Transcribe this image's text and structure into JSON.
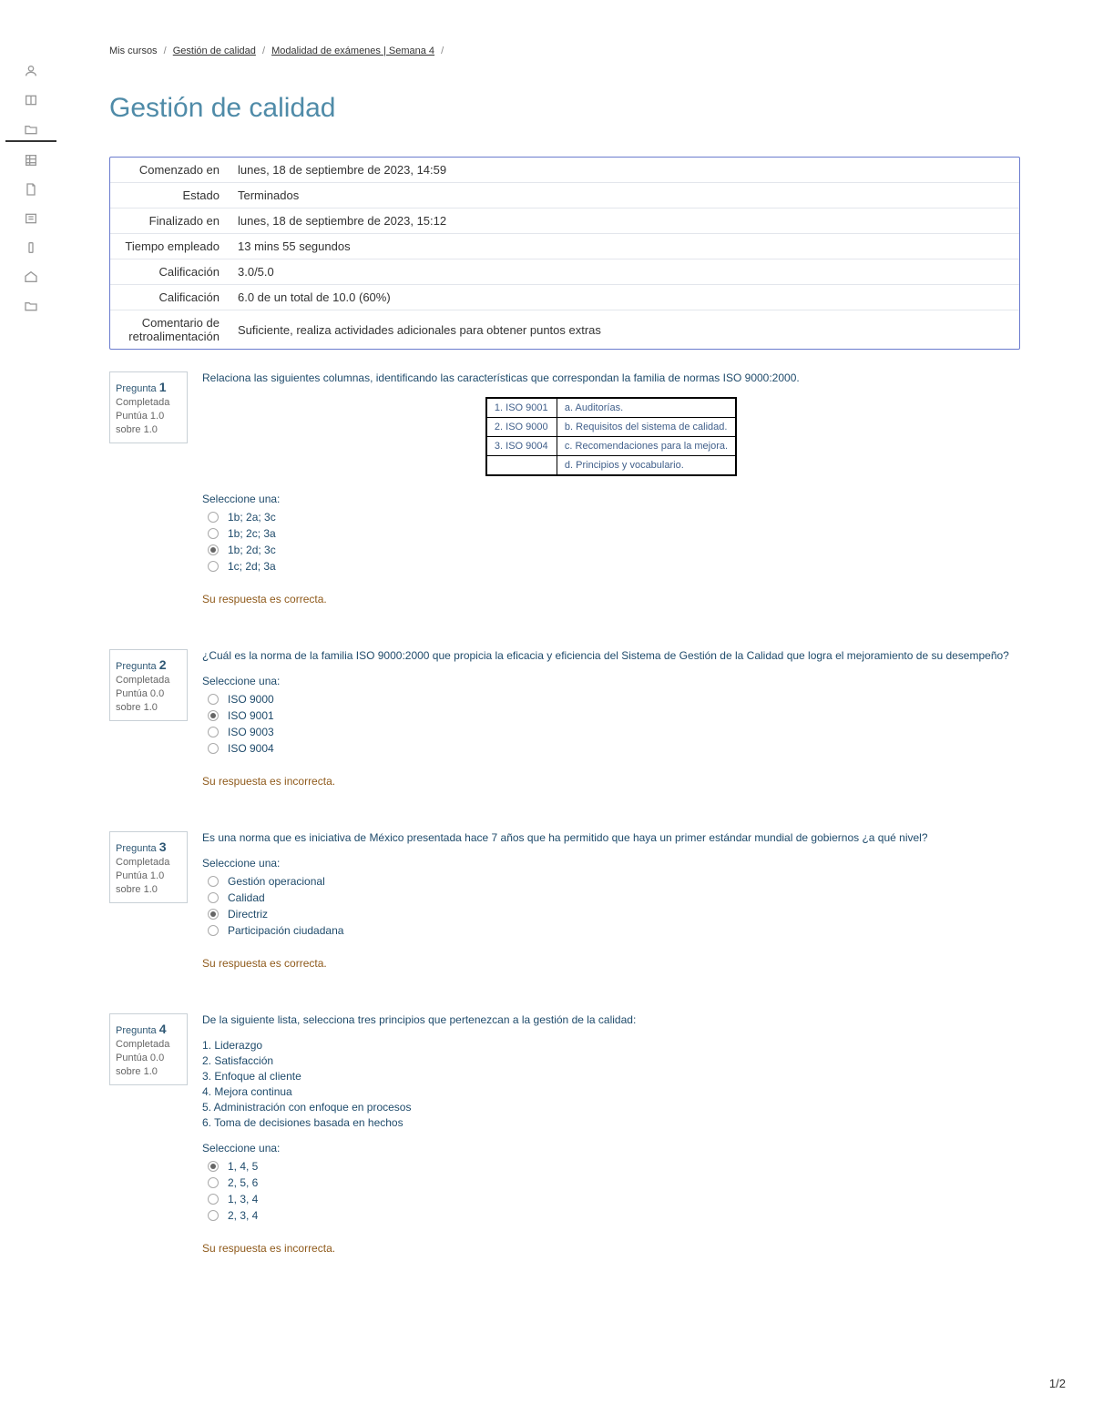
{
  "breadcrumb": {
    "i1": "Mis cursos",
    "i2": "Gestión de calidad",
    "i3": "Modalidad de exámenes | Semana 4"
  },
  "page_title": "Gestión de calidad",
  "summary": {
    "started_label": "Comenzado en",
    "started_value": "lunes, 18 de septiembre de 2023, 14:59",
    "state_label": "Estado",
    "state_value": "Terminados",
    "finished_label": "Finalizado en",
    "finished_value": "lunes, 18 de septiembre de 2023, 15:12",
    "time_label": "Tiempo empleado",
    "time_value": "13 mins 55 segundos",
    "grade1_label": "Calificación",
    "grade1_value": "3.0/5.0",
    "grade2_label": "Calificación",
    "grade2_value": "6.0 de un total de 10.0 (60%)",
    "feedback_label": "Comentario de retroalimentación",
    "feedback_value": "Suficiente, realiza actividades adicionales para obtener puntos extras"
  },
  "labels": {
    "question_prefix": "Pregunta ",
    "completed": "Completada",
    "score_prefix": "Puntúa ",
    "over_prefix": "sobre ",
    "select_one": "Seleccione una:",
    "correct": "Su respuesta es correcta.",
    "incorrect": "Su respuesta es incorrecta."
  },
  "q1": {
    "num": "1",
    "score": "1.0",
    "over": "1.0",
    "text": "Relaciona las siguientes columnas, identificando las características que correspondan la familia de normas ISO 9000:2000.",
    "match": {
      "r1c1": "1. ISO 9001",
      "r1c2": "a. Auditorías.",
      "r2c1": "2. ISO 9000",
      "r2c2": "b. Requisitos del sistema de calidad.",
      "r3c1": "3. ISO 9004",
      "r3c2": "c. Recomendaciones para la mejora.",
      "r4c2": "d. Principios y vocabulario."
    },
    "opt_a": "1b; 2a; 3c",
    "opt_b": "1b; 2c; 3a",
    "opt_c": "1b; 2d; 3c",
    "opt_d": "1c; 2d; 3a",
    "feedback": "correct"
  },
  "q2": {
    "num": "2",
    "score": "0.0",
    "over": "1.0",
    "text": "¿Cuál es la norma de la familia ISO 9000:2000 que propicia la eficacia y eficiencia del Sistema de Gestión de la Calidad que logra el mejoramiento de su desempeño?",
    "opt_a": "ISO 9000",
    "opt_b": "ISO 9001",
    "opt_c": "ISO 9003",
    "opt_d": "ISO 9004",
    "feedback": "incorrect"
  },
  "q3": {
    "num": "3",
    "score": "1.0",
    "over": "1.0",
    "text": "Es una norma que es iniciativa de México presentada hace 7 años que ha permitido que haya un primer estándar mundial de gobiernos ¿a qué nivel?",
    "opt_a": "Gestión operacional",
    "opt_b": "Calidad",
    "opt_c": "Directriz",
    "opt_d": "Participación ciudadana",
    "feedback": "correct"
  },
  "q4": {
    "num": "4",
    "score": "0.0",
    "over": "1.0",
    "text": "De la siguiente lista, selecciona tres principios que pertenezcan a la gestión de la calidad:",
    "list": {
      "l1": "1. Liderazgo",
      "l2": "2. Satisfacción",
      "l3": "3. Enfoque al cliente",
      "l4": "4. Mejora continua",
      "l5": "5. Administración con enfoque en procesos",
      "l6": "6. Toma de decisiones basada en hechos"
    },
    "opt_a": "1, 4, 5",
    "opt_b": "2, 5, 6",
    "opt_c": "1, 3, 4",
    "opt_d": "2, 3, 4",
    "feedback": "incorrect"
  },
  "page_counter": "1/2"
}
